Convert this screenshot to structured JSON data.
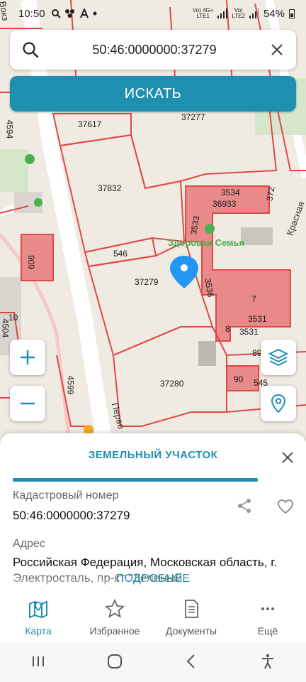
{
  "status_bar": {
    "time": "10:50",
    "sim1": "LTE1",
    "sim2": "LTE2",
    "net1": "Vo) 4G+",
    "net2": "Vo)",
    "battery": "54%"
  },
  "search": {
    "value": "50:46:0000000:37279",
    "button_label": "ИСКАТЬ"
  },
  "map": {
    "parcel_labels": [
      "37617",
      "37277",
      "37832",
      "3534",
      "36933",
      "372",
      "3533",
      "546",
      "37279",
      "3536",
      "7",
      "3531",
      "8",
      "3531",
      "89",
      "90",
      "37280",
      "4594",
      "909",
      "4504",
      "10",
      "4599",
      "545"
    ],
    "poi": "Здоровая Семья",
    "street_1": "Красная",
    "street_2": "Перво",
    "street_3": "Вокз",
    "accent_red": "#e04848",
    "building_fill": "#e88a8a"
  },
  "sheet": {
    "title": "ЗЕМЕЛЬНЫЙ УЧАСТОК",
    "cadastral_label": "Кадастровый номер",
    "cadastral_value": "50:46:0000000:37279",
    "address_label": "Адрес",
    "address_value": "Российская Федерация, Московская область, г. Электросталь, пр-кт \"Зеленый",
    "more_link": "ПОДРОБНЕЕ"
  },
  "nav": {
    "items": [
      {
        "label": "Карта",
        "icon": "map-icon",
        "active": true
      },
      {
        "label": "Избранное",
        "icon": "star-icon",
        "active": false
      },
      {
        "label": "Документы",
        "icon": "document-icon",
        "active": false
      },
      {
        "label": "Ещё",
        "icon": "more-icon",
        "active": false
      }
    ]
  },
  "colors": {
    "accent": "#1f8fb0",
    "pin": "#2196f3"
  }
}
